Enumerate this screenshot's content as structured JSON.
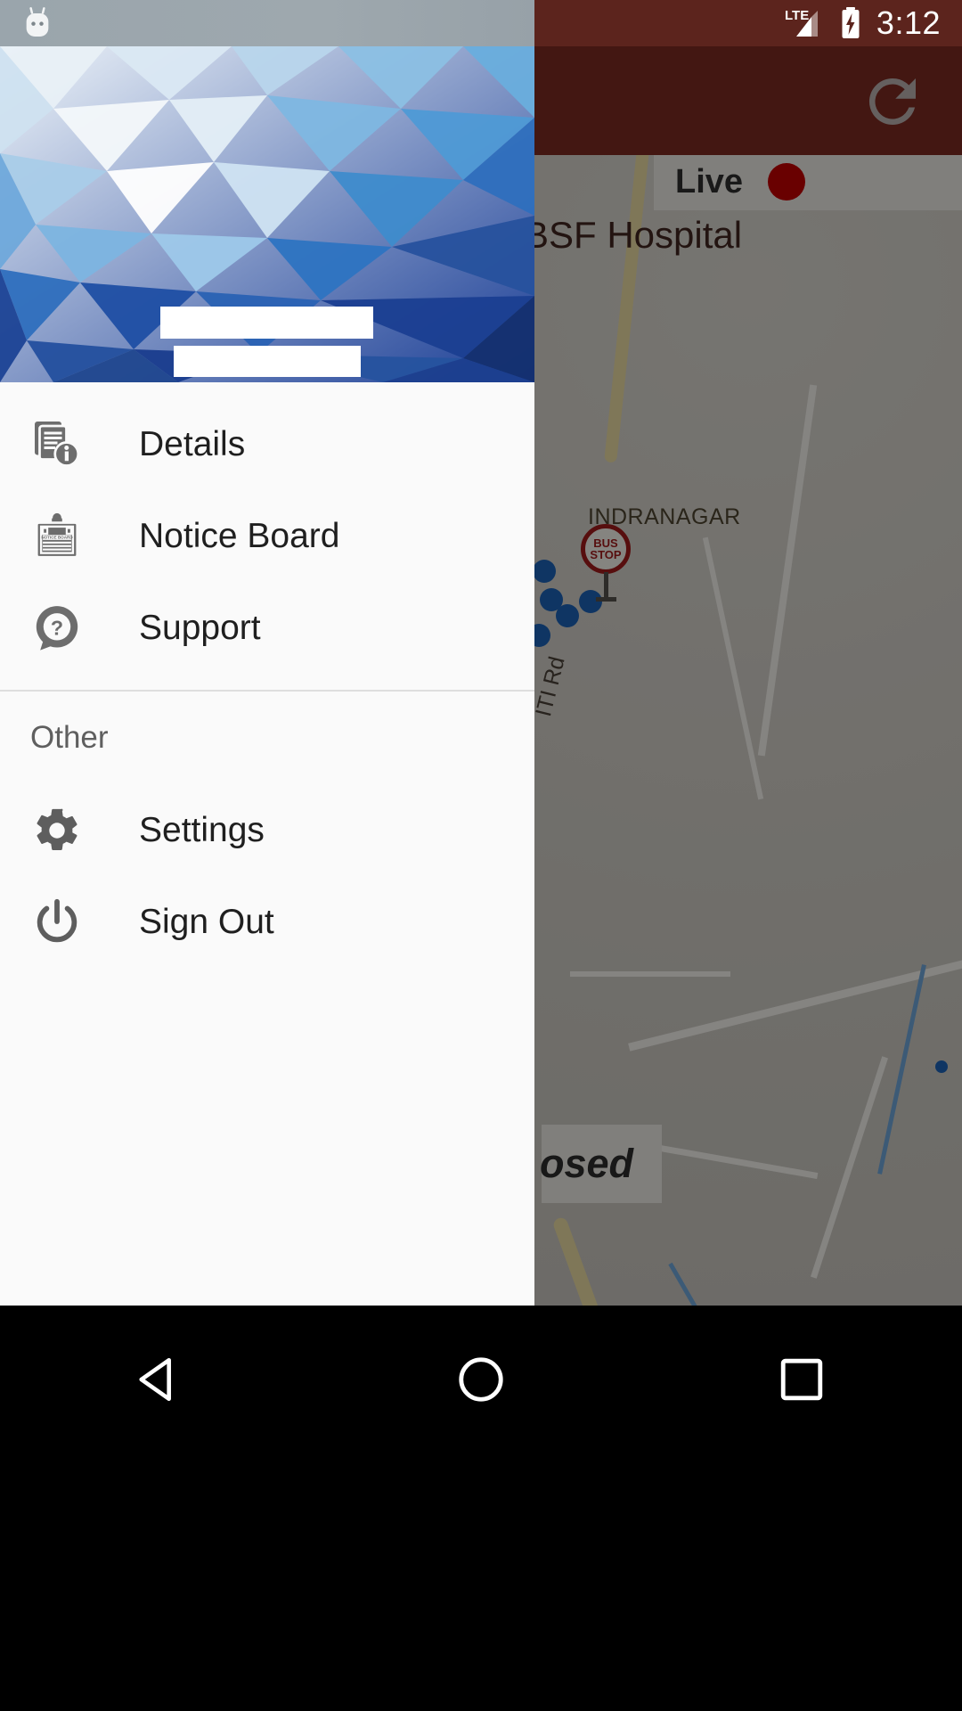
{
  "status_bar": {
    "time": "3:12",
    "network_label": "LTE",
    "mascot_icon": "android-mascot-icon",
    "signal_icon": "signal-bars-icon",
    "battery_icon": "battery-charging-icon"
  },
  "toolbar": {
    "refresh_icon": "refresh-icon",
    "background_color": "#7b2a22"
  },
  "map": {
    "live_chip": {
      "label": "Live",
      "dot_color": "#c00000",
      "dot_icon": "live-record-dot-icon"
    },
    "labels": [
      {
        "text": "BSF Hospital",
        "name": "map-label-bsf-hospital"
      },
      {
        "text": "INDRANAGAR",
        "name": "map-label-indranagar"
      },
      {
        "text": "ITI Rd",
        "name": "map-label-iti-rd"
      }
    ],
    "bus_stop_marker": {
      "line1": "BUS",
      "line2": "STOP",
      "color": "#9e1b1b"
    },
    "closed_card": {
      "text": "osed"
    },
    "vehicle_trail_dots": 6,
    "trail_dot_color": "#1d62b5"
  },
  "drawer": {
    "header": {
      "account_name_redacted": "",
      "account_email_redacted": ""
    },
    "items": [
      {
        "label": "Details",
        "icon": "documents-info-icon"
      },
      {
        "label": "Notice Board",
        "icon": "clipboard-notice-board-icon"
      },
      {
        "label": "Support",
        "icon": "question-speech-bubble-icon"
      }
    ],
    "section_other": {
      "label": "Other"
    },
    "other_items": [
      {
        "label": "Settings",
        "icon": "gear-icon"
      },
      {
        "label": "Sign Out",
        "icon": "power-icon"
      }
    ]
  },
  "system_nav": {
    "back_icon": "back-triangle-icon",
    "home_icon": "home-circle-icon",
    "recents_icon": "recents-square-icon"
  }
}
